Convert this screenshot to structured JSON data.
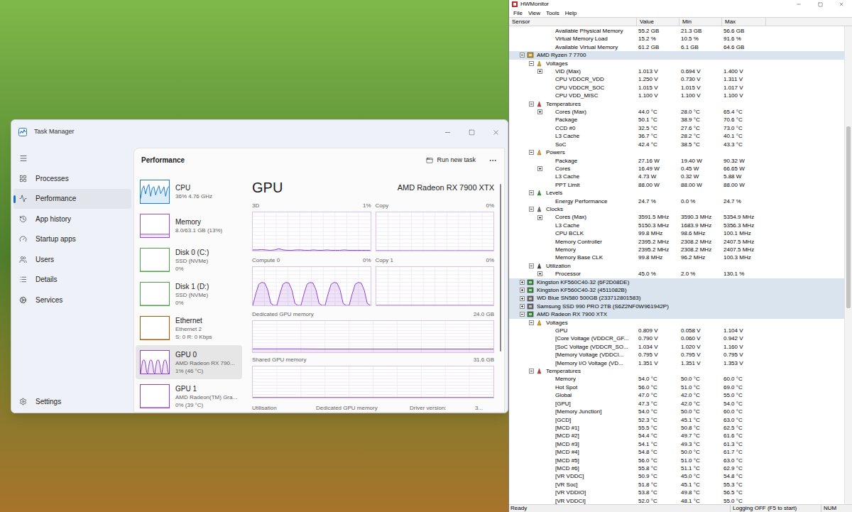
{
  "taskManager": {
    "title": "Task Manager",
    "nav": [
      {
        "label": "Processes",
        "selected": false
      },
      {
        "label": "Performance",
        "selected": true
      },
      {
        "label": "App history",
        "selected": false
      },
      {
        "label": "Startup apps",
        "selected": false
      },
      {
        "label": "Users",
        "selected": false
      },
      {
        "label": "Details",
        "selected": false
      },
      {
        "label": "Services",
        "selected": false
      }
    ],
    "settings": {
      "label": "Settings",
      "selected": false
    },
    "header": "Performance",
    "runNewTask": "Run new task",
    "devices": [
      {
        "name": "CPU",
        "lines": [
          "36% 4.76 GHz"
        ],
        "selected": false,
        "color": "#1a7fd4",
        "values": [
          20,
          62,
          76,
          40,
          70,
          82,
          30,
          66,
          72,
          36,
          60,
          76,
          42,
          56,
          72,
          30,
          64,
          74
        ]
      },
      {
        "name": "Memory",
        "lines": [
          "8.0/63.1 GB (13%)"
        ],
        "selected": false,
        "color": "#9b4dca",
        "values": [
          13,
          13,
          13,
          13,
          13,
          13,
          13,
          13,
          13,
          13
        ]
      },
      {
        "name": "Disk 0 (C:)",
        "lines": [
          "SSD (NVMe)",
          "0%"
        ],
        "selected": false,
        "color": "#4da345",
        "values": [
          0,
          0,
          0,
          0,
          0,
          0
        ]
      },
      {
        "name": "Disk 1 (D:)",
        "lines": [
          "SSD (NVMe)",
          "0%"
        ],
        "selected": false,
        "color": "#4da345",
        "values": [
          0,
          0,
          0,
          0,
          0,
          0
        ]
      },
      {
        "name": "Ethernet",
        "lines": [
          "Ethernet 2",
          "S: 0 R: 0 Kbps"
        ],
        "selected": false,
        "color": "#b05a00",
        "values": [
          0,
          0,
          0,
          0,
          0,
          0
        ]
      },
      {
        "name": "GPU 0",
        "lines": [
          "AMD Radeon RX 790...",
          "1% (46 °C)"
        ],
        "selected": true,
        "color": "#8e44c9",
        "values": [
          0,
          30,
          55,
          60,
          58,
          40,
          5,
          0,
          30,
          55,
          60,
          58,
          40,
          5,
          0,
          30,
          55,
          60,
          58,
          40,
          5,
          0,
          30,
          55,
          60,
          58,
          40,
          5,
          0
        ]
      },
      {
        "name": "GPU 1",
        "lines": [
          "AMD Radeon(TM) Gra...",
          "0% (39 °C)"
        ],
        "selected": false,
        "color": "#8e44c9",
        "values": [
          0,
          0,
          0,
          0,
          0,
          0
        ]
      }
    ],
    "detail": {
      "title": "GPU",
      "device": "AMD Radeon RX 7900 XTX",
      "engines": [
        {
          "label": "3D",
          "reading": "1%",
          "values": [
            2,
            2,
            3,
            2,
            1,
            2,
            5,
            2,
            1,
            1,
            2,
            2,
            1,
            1,
            2,
            1,
            1,
            2,
            1,
            1,
            1,
            2,
            1,
            1,
            1,
            1,
            1,
            1
          ]
        },
        {
          "label": "Copy",
          "reading": "0%",
          "values": [
            0,
            0,
            0,
            0,
            0,
            0,
            0,
            0,
            0,
            0
          ]
        },
        {
          "label": "Compute 0",
          "reading": "0%",
          "values": [
            0,
            30,
            55,
            60,
            58,
            40,
            5,
            0,
            0,
            30,
            55,
            60,
            58,
            40,
            5,
            0,
            0,
            30,
            55,
            60,
            58,
            40,
            5,
            0,
            0,
            30,
            55,
            60,
            58,
            40,
            5,
            0,
            0,
            30,
            55,
            60,
            58,
            40,
            5,
            0
          ]
        },
        {
          "label": "Copy 1",
          "reading": "0%",
          "values": [
            0,
            0,
            0,
            0,
            0,
            0,
            0,
            0,
            0,
            0
          ]
        }
      ],
      "memory": [
        {
          "label": "Dedicated GPU memory",
          "reading": "24.0 GB",
          "max": 24,
          "values": [
            2.6,
            2.6,
            2.6,
            2.5,
            2.5,
            2.5,
            2.5,
            2.4,
            2.4,
            2.4,
            2.4,
            2.4
          ]
        },
        {
          "label": "Shared GPU memory",
          "reading": "31.6 GB",
          "max": 31.6,
          "values": [
            0.2,
            0.2,
            0.2,
            0.2,
            0.2,
            0.2,
            0.2,
            0.2
          ]
        }
      ],
      "footer": [
        "Utilisation",
        "Dedicated GPU memory",
        "Driver version:",
        "3..."
      ]
    },
    "scrollbar": {
      "level": 0.7,
      "offset": 0.05
    }
  },
  "hwmonitor": {
    "title": "HWMonitor",
    "menu": [
      "File",
      "View",
      "Tools",
      "Help"
    ],
    "columns": [
      "Sensor",
      "Value",
      "Min",
      "Max"
    ],
    "rows": [
      {
        "kind": "sensor",
        "label": "Available Physical Memory",
        "value": "55.2 GB",
        "min": "21.3 GB",
        "max": "56.6 GB"
      },
      {
        "kind": "sensor",
        "label": "Virtual Memory Load",
        "value": "15.2 %",
        "min": "10.5 %",
        "max": "91.6 %"
      },
      {
        "kind": "sensor",
        "label": "Available Virtual Memory",
        "value": "61.2 GB",
        "min": "6.1 GB",
        "max": "64.6 GB"
      },
      {
        "kind": "device",
        "label": "AMD Ryzen 7 7700",
        "expanded": true,
        "color": "#c89a2c"
      },
      {
        "kind": "group",
        "label": "Voltages",
        "expanded": true,
        "color": "#e0a800"
      },
      {
        "kind": "sensor",
        "label": "VID (Max)",
        "value": "1.013 V",
        "min": "0.694 V",
        "max": "1.400 V",
        "expanded": false
      },
      {
        "kind": "sensor",
        "label": "CPU VDDCR_VDD",
        "value": "1.250 V",
        "min": "0.730 V",
        "max": "1.311 V"
      },
      {
        "kind": "sensor",
        "label": "CPU VDDCR_SOC",
        "value": "1.015 V",
        "min": "1.015 V",
        "max": "1.017 V"
      },
      {
        "kind": "sensor",
        "label": "CPU VDD_MISC",
        "value": "1.100 V",
        "min": "1.100 V",
        "max": "1.100 V"
      },
      {
        "kind": "group",
        "label": "Temperatures",
        "expanded": true,
        "color": "#d23a2a"
      },
      {
        "kind": "sensor",
        "label": "Cores (Max)",
        "value": "44.0 °C",
        "min": "28.0 °C",
        "max": "65.4 °C",
        "expanded": false
      },
      {
        "kind": "sensor",
        "label": "Package",
        "value": "50.1 °C",
        "min": "38.9 °C",
        "max": "70.6 °C"
      },
      {
        "kind": "sensor",
        "label": "CCD #0",
        "value": "32.5 °C",
        "min": "27.6 °C",
        "max": "73.0 °C"
      },
      {
        "kind": "sensor",
        "label": "L3 Cache",
        "value": "36.7 °C",
        "min": "28.2 °C",
        "max": "40.1 °C"
      },
      {
        "kind": "sensor",
        "label": "SoC",
        "value": "42.4 °C",
        "min": "38.5 °C",
        "max": "43.3 °C"
      },
      {
        "kind": "group",
        "label": "Powers",
        "expanded": true,
        "color": "#f0a020"
      },
      {
        "kind": "sensor",
        "label": "Package",
        "value": "27.16 W",
        "min": "19.40 W",
        "max": "90.32 W"
      },
      {
        "kind": "sensor",
        "label": "Cores",
        "value": "16.49 W",
        "min": "0.45 W",
        "max": "66.65 W",
        "expanded": false
      },
      {
        "kind": "sensor",
        "label": "L3 Cache",
        "value": "4.73 W",
        "min": "0.32 W",
        "max": "5.88 W"
      },
      {
        "kind": "sensor",
        "label": "PPT Limit",
        "value": "88.00 W",
        "min": "88.00 W",
        "max": "88.00 W"
      },
      {
        "kind": "group",
        "label": "Levels",
        "expanded": true,
        "color": "#2f9a3a"
      },
      {
        "kind": "sensor",
        "label": "Energy Performance",
        "value": "24.7 %",
        "min": "0.0 %",
        "max": "24.7 %"
      },
      {
        "kind": "group",
        "label": "Clocks",
        "expanded": true,
        "color": "#707070"
      },
      {
        "kind": "sensor",
        "label": "Cores (Max)",
        "value": "3591.5 MHz",
        "min": "3590.3 MHz",
        "max": "5354.9 MHz",
        "expanded": false
      },
      {
        "kind": "sensor",
        "label": "L3 Cache",
        "value": "5150.3 MHz",
        "min": "1683.9 MHz",
        "max": "5356.3 MHz"
      },
      {
        "kind": "sensor",
        "label": "CPU BCLK",
        "value": "99.8 MHz",
        "min": "98.6 MHz",
        "max": "100.1 MHz"
      },
      {
        "kind": "sensor",
        "label": "Memory Controller",
        "value": "2395.2 MHz",
        "min": "2308.2 MHz",
        "max": "2407.5 MHz"
      },
      {
        "kind": "sensor",
        "label": "Memory",
        "value": "2395.2 MHz",
        "min": "2308.2 MHz",
        "max": "2407.5 MHz"
      },
      {
        "kind": "sensor",
        "label": "Memory Base CLK",
        "value": "99.8 MHz",
        "min": "96.2 MHz",
        "max": "100.3 MHz"
      },
      {
        "kind": "group",
        "label": "Utilization",
        "expanded": true,
        "color": "#404040"
      },
      {
        "kind": "sensor",
        "label": "Processor",
        "value": "45.0 %",
        "min": "2.0 %",
        "max": "130.1 %",
        "expanded": false
      },
      {
        "kind": "device",
        "label": "Kingston KF560C40-32 (6F2D08DE)",
        "expanded": false,
        "color": "#3c8a3c"
      },
      {
        "kind": "device",
        "label": "Kingston KF560C40-32 (4511082B)",
        "expanded": false,
        "color": "#3c8a3c"
      },
      {
        "kind": "device",
        "label": "WD Blue SN580 500GB (233712801583)",
        "expanded": false,
        "color": "#6b6b6b"
      },
      {
        "kind": "device",
        "label": "Samsung SSD 990 PRO 2TB (S6Z2NF0W961942P)",
        "expanded": false,
        "color": "#6b6b6b"
      },
      {
        "kind": "device",
        "label": "AMD Radeon RX 7900 XTX",
        "expanded": true,
        "color": "#3c8a3c"
      },
      {
        "kind": "group",
        "label": "Voltages",
        "expanded": true,
        "color": "#e0a800"
      },
      {
        "kind": "sensor",
        "label": "GPU",
        "value": "0.809 V",
        "min": "0.058 V",
        "max": "1.104 V"
      },
      {
        "kind": "sensor",
        "label": "[Core Voltage (VDDCR_GF...",
        "value": "0.790 V",
        "min": "0.060 V",
        "max": "0.942 V"
      },
      {
        "kind": "sensor",
        "label": "[SoC Voltage (VDDCR_SO...",
        "value": "1.034 V",
        "min": "1.020 V",
        "max": "1.160 V"
      },
      {
        "kind": "sensor",
        "label": "[Memory Voltage (VDDCI...",
        "value": "0.795 V",
        "min": "0.795 V",
        "max": "0.795 V"
      },
      {
        "kind": "sensor",
        "label": "[Memory I/O Voltage (VD...",
        "value": "1.351 V",
        "min": "1.351 V",
        "max": "1.353 V"
      },
      {
        "kind": "group",
        "label": "Temperatures",
        "expanded": true,
        "color": "#d23a2a"
      },
      {
        "kind": "sensor",
        "label": "Memory",
        "value": "54.0 °C",
        "min": "50.0 °C",
        "max": "60.0 °C"
      },
      {
        "kind": "sensor",
        "label": "Hot Spot",
        "value": "56.0 °C",
        "min": "51.0 °C",
        "max": "69.0 °C"
      },
      {
        "kind": "sensor",
        "label": "Global",
        "value": "47.0 °C",
        "min": "42.0 °C",
        "max": "55.0 °C"
      },
      {
        "kind": "sensor",
        "label": "[GPU]",
        "value": "47.3 °C",
        "min": "42.0 °C",
        "max": "54.0 °C"
      },
      {
        "kind": "sensor",
        "label": "[Memory Junction]",
        "value": "54.0 °C",
        "min": "50.0 °C",
        "max": "60.0 °C"
      },
      {
        "kind": "sensor",
        "label": "[GCD]",
        "value": "52.3 °C",
        "min": "45.1 °C",
        "max": "63.0 °C"
      },
      {
        "kind": "sensor",
        "label": "[MCD #1]",
        "value": "55.5 °C",
        "min": "50.8 °C",
        "max": "62.5 °C"
      },
      {
        "kind": "sensor",
        "label": "[MCD #2]",
        "value": "54.4 °C",
        "min": "49.7 °C",
        "max": "61.6 °C"
      },
      {
        "kind": "sensor",
        "label": "[MCD #3]",
        "value": "54.1 °C",
        "min": "49.3 °C",
        "max": "61.3 °C"
      },
      {
        "kind": "sensor",
        "label": "[MCD #4]",
        "value": "54.8 °C",
        "min": "50.0 °C",
        "max": "61.7 °C"
      },
      {
        "kind": "sensor",
        "label": "[MCD #5]",
        "value": "56.0 °C",
        "min": "51.0 °C",
        "max": "63.0 °C"
      },
      {
        "kind": "sensor",
        "label": "[MCD #6]",
        "value": "55.8 °C",
        "min": "51.1 °C",
        "max": "62.9 °C"
      },
      {
        "kind": "sensor",
        "label": "[VR VDDC]",
        "value": "50.9 °C",
        "min": "45.0 °C",
        "max": "54.8 °C"
      },
      {
        "kind": "sensor",
        "label": "[VR Soc]",
        "value": "51.8 °C",
        "min": "45.1 °C",
        "max": "55.3 °C"
      },
      {
        "kind": "sensor",
        "label": "[VR VDDIO]",
        "value": "53.8 °C",
        "min": "49.8 °C",
        "max": "56.5 °C"
      },
      {
        "kind": "sensor",
        "label": "[VR VDDCI]",
        "value": "52.0 °C",
        "min": "48.1 °C",
        "max": "55.0 °C"
      }
    ],
    "scrollbar": {
      "level": 0.38,
      "offset": 0.21
    },
    "status": [
      "Ready",
      "Logging OFF (F5 to start)",
      "NUM"
    ]
  }
}
